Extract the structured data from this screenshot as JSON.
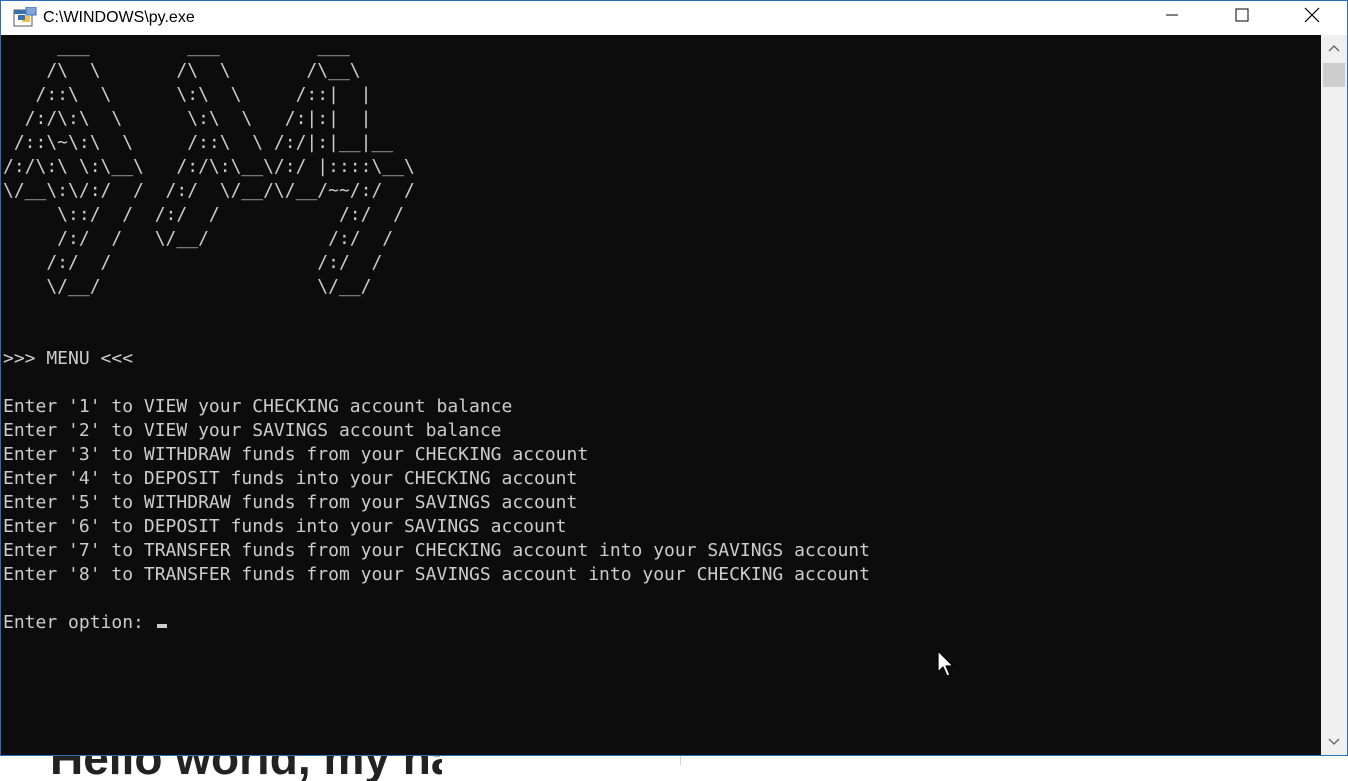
{
  "window": {
    "title": "C:\\WINDOWS\\py.exe",
    "icon": "python-console-icon",
    "controls": {
      "minimize": "minimize-icon",
      "maximize": "maximize-icon",
      "close": "close-icon"
    }
  },
  "console": {
    "ascii_art": "     ___         ___         ___\n    /\\  \\       /\\  \\       /\\__\\\n   /::\\  \\      \\:\\  \\     /::|  |\n  /:/\\:\\  \\      \\:\\  \\   /:|:|  |\n /::\\~\\:\\  \\     /::\\  \\ /:/|:|__|__\n/:/\\:\\ \\:\\__\\   /:/\\:\\__\\/:/ |::::\\__\\\n\\/__\\:\\/:/  /  /:/  \\/__/\\/__/~~/:/  /\n     \\::/  /  /:/  /           /:/  /\n     /:/  /   \\/__/           /:/  /\n    /:/  /                   /:/  /\n    \\/__/                    \\/__/",
    "menu_header": ">>> MENU <<<",
    "menu_items": [
      "Enter '1' to VIEW your CHECKING account balance",
      "Enter '2' to VIEW your SAVINGS account balance",
      "Enter '3' to WITHDRAW funds from your CHECKING account",
      "Enter '4' to DEPOSIT funds into your CHECKING account",
      "Enter '5' to WITHDRAW funds from your SAVINGS account",
      "Enter '6' to DEPOSIT funds into your SAVINGS account",
      "Enter '7' to TRANSFER funds from your CHECKING account into your SAVINGS account",
      "Enter '8' to TRANSFER funds from your SAVINGS account into your CHECKING account"
    ],
    "prompt": "Enter option: ",
    "input_value": ""
  },
  "background": {
    "heading": "Hello world, my na"
  },
  "colors": {
    "console_bg": "#0c0c0c",
    "console_fg": "#cccccc",
    "titlebar_bg": "#ffffff",
    "scrollbar_bg": "#f0f0f0"
  }
}
